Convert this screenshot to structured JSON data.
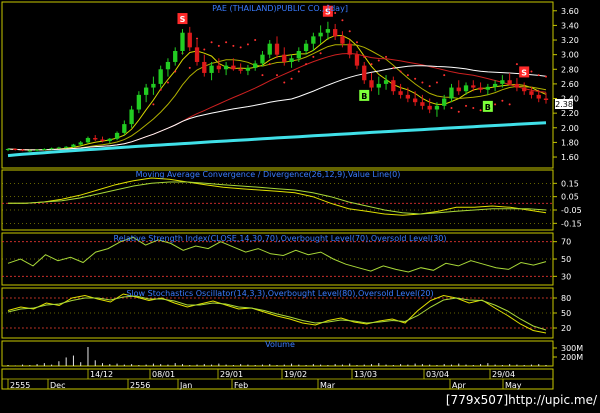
{
  "chart_data": [
    {
      "panel": "price",
      "type": "candlestick",
      "title": "PAE (THAILAND)PUBLIC CO., [day]",
      "ylim": [
        1.45,
        3.72
      ],
      "yticks": [
        "1.60",
        "1.80",
        "2.00",
        "2.20",
        "2.40",
        "2.60",
        "2.80",
        "3.00",
        "3.20",
        "3.40",
        "3.60"
      ],
      "last_price": "2.38",
      "candles": [
        [
          1.7,
          1.72,
          1.68,
          1.71
        ],
        [
          1.71,
          1.72,
          1.69,
          1.7
        ],
        [
          1.7,
          1.71,
          1.68,
          1.69
        ],
        [
          1.69,
          1.7,
          1.67,
          1.69
        ],
        [
          1.69,
          1.71,
          1.68,
          1.7
        ],
        [
          1.7,
          1.72,
          1.69,
          1.71
        ],
        [
          1.71,
          1.73,
          1.7,
          1.72
        ],
        [
          1.72,
          1.74,
          1.71,
          1.73
        ],
        [
          1.73,
          1.75,
          1.72,
          1.74
        ],
        [
          1.74,
          1.78,
          1.73,
          1.77
        ],
        [
          1.77,
          1.82,
          1.76,
          1.8
        ],
        [
          1.8,
          1.88,
          1.79,
          1.86
        ],
        [
          1.86,
          1.9,
          1.82,
          1.84
        ],
        [
          1.84,
          1.88,
          1.8,
          1.82
        ],
        [
          1.82,
          1.86,
          1.79,
          1.85
        ],
        [
          1.85,
          1.95,
          1.83,
          1.93
        ],
        [
          1.93,
          2.1,
          1.9,
          2.05
        ],
        [
          2.05,
          2.3,
          2.0,
          2.25
        ],
        [
          2.25,
          2.5,
          2.2,
          2.45
        ],
        [
          2.45,
          2.6,
          2.35,
          2.55
        ],
        [
          2.55,
          2.7,
          2.45,
          2.6
        ],
        [
          2.6,
          2.85,
          2.55,
          2.8
        ],
        [
          2.8,
          2.95,
          2.7,
          2.9
        ],
        [
          2.9,
          3.1,
          2.85,
          3.05
        ],
        [
          3.05,
          3.35,
          3.0,
          3.3
        ],
        [
          3.3,
          3.38,
          3.05,
          3.1
        ],
        [
          3.1,
          3.2,
          2.85,
          2.9
        ],
        [
          2.9,
          3.0,
          2.7,
          2.75
        ],
        [
          2.75,
          2.9,
          2.65,
          2.85
        ],
        [
          2.85,
          2.95,
          2.75,
          2.8
        ],
        [
          2.8,
          2.9,
          2.72,
          2.85
        ],
        [
          2.85,
          2.95,
          2.78,
          2.8
        ],
        [
          2.8,
          2.88,
          2.74,
          2.78
        ],
        [
          2.78,
          2.86,
          2.72,
          2.82
        ],
        [
          2.82,
          2.92,
          2.78,
          2.88
        ],
        [
          2.88,
          3.05,
          2.84,
          3.0
        ],
        [
          3.0,
          3.2,
          2.95,
          3.15
        ],
        [
          3.15,
          3.25,
          2.95,
          3.0
        ],
        [
          3.0,
          3.1,
          2.85,
          2.9
        ],
        [
          2.9,
          3.0,
          2.82,
          2.95
        ],
        [
          2.95,
          3.1,
          2.9,
          3.05
        ],
        [
          3.05,
          3.2,
          3.0,
          3.15
        ],
        [
          3.15,
          3.3,
          3.05,
          3.25
        ],
        [
          3.25,
          3.4,
          3.15,
          3.3
        ],
        [
          3.3,
          3.45,
          3.2,
          3.35
        ],
        [
          3.35,
          3.42,
          3.2,
          3.25
        ],
        [
          3.25,
          3.32,
          3.1,
          3.15
        ],
        [
          3.15,
          3.2,
          2.95,
          3.0
        ],
        [
          3.0,
          3.05,
          2.8,
          2.85
        ],
        [
          2.85,
          2.9,
          2.6,
          2.65
        ],
        [
          2.65,
          2.75,
          2.5,
          2.55
        ],
        [
          2.55,
          2.7,
          2.45,
          2.6
        ],
        [
          2.6,
          2.72,
          2.52,
          2.65
        ],
        [
          2.65,
          2.7,
          2.45,
          2.5
        ],
        [
          2.5,
          2.6,
          2.4,
          2.45
        ],
        [
          2.45,
          2.55,
          2.35,
          2.4
        ],
        [
          2.4,
          2.5,
          2.3,
          2.35
        ],
        [
          2.35,
          2.45,
          2.25,
          2.3
        ],
        [
          2.3,
          2.4,
          2.2,
          2.25
        ],
        [
          2.25,
          2.35,
          2.15,
          2.3
        ],
        [
          2.3,
          2.45,
          2.25,
          2.4
        ],
        [
          2.4,
          2.6,
          2.35,
          2.55
        ],
        [
          2.55,
          2.65,
          2.45,
          2.5
        ],
        [
          2.5,
          2.62,
          2.45,
          2.58
        ],
        [
          2.58,
          2.65,
          2.5,
          2.55
        ],
        [
          2.55,
          2.62,
          2.48,
          2.52
        ],
        [
          2.52,
          2.6,
          2.45,
          2.56
        ],
        [
          2.56,
          2.65,
          2.5,
          2.6
        ],
        [
          2.6,
          2.72,
          2.55,
          2.65
        ],
        [
          2.65,
          2.75,
          2.58,
          2.6
        ],
        [
          2.6,
          2.68,
          2.5,
          2.55
        ],
        [
          2.55,
          2.62,
          2.45,
          2.5
        ],
        [
          2.5,
          2.56,
          2.4,
          2.45
        ],
        [
          2.45,
          2.52,
          2.35,
          2.4
        ],
        [
          2.4,
          2.48,
          2.33,
          2.38
        ]
      ],
      "signals": [
        {
          "type": "S",
          "index": 24
        },
        {
          "type": "S",
          "index": 44
        },
        {
          "type": "B",
          "index": 49
        },
        {
          "type": "B",
          "index": 66
        },
        {
          "type": "S",
          "index": 71
        }
      ]
    },
    {
      "panel": "macd",
      "type": "line",
      "title": "Moving Average Convergence / Divergence(26,12,9),Value Line(0)",
      "ylim": [
        -0.2,
        0.25
      ],
      "yticks": [
        "0.15",
        "0.05",
        "-0.05",
        "-0.15"
      ],
      "series": [
        {
          "values": [
            0.0,
            0.0,
            0.01,
            0.03,
            0.06,
            0.1,
            0.14,
            0.17,
            0.19,
            0.18,
            0.16,
            0.14,
            0.12,
            0.11,
            0.1,
            0.09,
            0.08,
            0.05,
            0.0,
            -0.04,
            -0.06,
            -0.08,
            -0.09,
            -0.08,
            -0.06,
            -0.03,
            -0.03,
            -0.02,
            -0.03,
            -0.05,
            -0.07
          ]
        },
        {
          "values": [
            0.0,
            0.0,
            0.01,
            0.02,
            0.04,
            0.07,
            0.1,
            0.13,
            0.15,
            0.16,
            0.16,
            0.15,
            0.14,
            0.13,
            0.12,
            0.11,
            0.1,
            0.08,
            0.05,
            0.01,
            -0.02,
            -0.05,
            -0.07,
            -0.08,
            -0.07,
            -0.06,
            -0.05,
            -0.04,
            -0.04,
            -0.04,
            -0.05
          ]
        }
      ]
    },
    {
      "panel": "rsi",
      "type": "line",
      "title": "Relative Strength Index(CLOSE,14,30,70),Overbought Level(70),Oversold Level(30)",
      "ylim": [
        20,
        80
      ],
      "yticks": [
        "70",
        "50",
        "30"
      ],
      "series": [
        {
          "values": [
            45,
            50,
            42,
            55,
            48,
            52,
            46,
            58,
            62,
            70,
            75,
            66,
            72,
            68,
            60,
            65,
            62,
            70,
            64,
            58,
            62,
            56,
            54,
            60,
            55,
            58,
            50,
            44,
            40,
            36,
            42,
            38,
            35,
            40,
            37,
            45,
            42,
            48,
            44,
            40,
            38,
            46,
            43,
            47
          ]
        }
      ]
    },
    {
      "panel": "stochastic",
      "type": "line",
      "title": "Slow Stochastics Oscillator(14,3,3),Overbought Level(80),Oversold Level(20)",
      "ylim": [
        0,
        100
      ],
      "yticks": [
        "80",
        "50",
        "20"
      ],
      "series": [
        {
          "values": [
            55,
            62,
            58,
            70,
            65,
            80,
            85,
            78,
            72,
            88,
            82,
            75,
            80,
            70,
            62,
            68,
            74,
            66,
            58,
            60,
            52,
            44,
            38,
            30,
            26,
            35,
            40,
            32,
            28,
            34,
            38,
            30,
            55,
            75,
            85,
            80,
            70,
            76,
            60,
            45,
            28,
            15,
            10
          ]
        },
        {
          "values": [
            52,
            58,
            60,
            66,
            68,
            75,
            80,
            80,
            76,
            82,
            84,
            78,
            78,
            74,
            66,
            66,
            70,
            68,
            62,
            60,
            55,
            48,
            42,
            35,
            30,
            32,
            36,
            34,
            30,
            32,
            35,
            33,
            45,
            62,
            76,
            80,
            76,
            75,
            66,
            54,
            38,
            24,
            16
          ]
        }
      ]
    },
    {
      "panel": "volume",
      "type": "bar",
      "title": "Volume",
      "yticks": [
        "300M",
        "200M"
      ],
      "values": [
        2,
        1,
        3,
        2,
        4,
        6,
        3,
        10,
        18,
        22,
        8,
        40,
        12,
        6,
        4,
        5,
        3,
        4,
        2,
        3,
        5,
        4,
        3,
        6,
        4,
        2,
        3,
        4,
        3,
        5,
        3,
        2,
        4,
        3,
        2,
        3,
        4,
        2,
        3,
        5,
        3,
        2,
        4,
        3,
        2,
        4,
        3,
        5,
        2,
        3,
        4,
        6,
        3,
        2,
        4,
        3,
        5,
        4,
        3,
        2,
        4,
        3,
        5,
        3,
        2,
        4,
        6,
        3,
        2,
        4,
        3,
        2,
        3,
        4,
        2
      ]
    }
  ],
  "x_axis": {
    "labels": [
      "2555",
      "Dec",
      "14/12",
      "2556",
      "08/01",
      "Jan",
      "29/01",
      "Feb",
      "19/02",
      "Mar",
      "13/03",
      "03/04",
      "Apr",
      "29/04",
      "May"
    ]
  },
  "watermark": "[779x507]http://upic.me/",
  "colors": {
    "frame": "#c8c800",
    "grid": "#c8c800",
    "text": "#c8c800",
    "title": "#3a7cff",
    "up": "#22cc22",
    "down": "#dd1a1a",
    "ma_white": "#ffffff",
    "ma_cyan": "#40e0e8",
    "ma_red": "#cc2020",
    "ma_yellow": "#d8d800",
    "sar": "#ff3030",
    "ind_yellow": "#e0e000",
    "ind_green": "#a8d838",
    "ref_line": "#e03030"
  }
}
